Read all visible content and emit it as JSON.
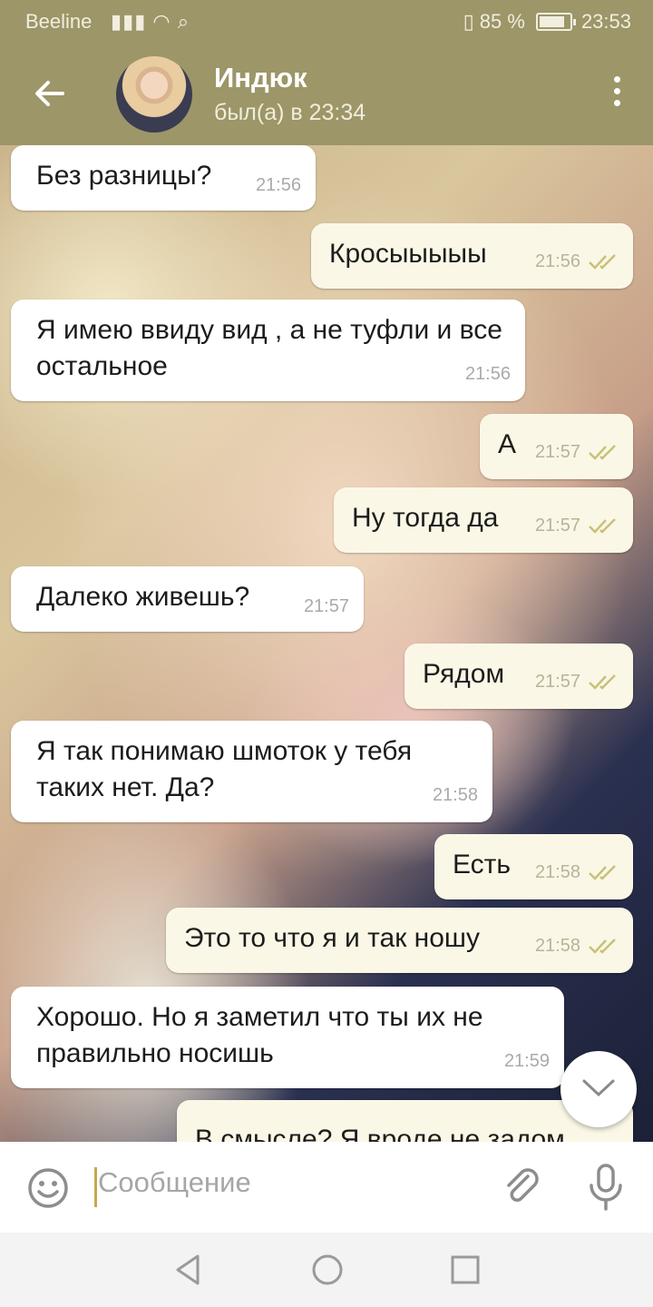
{
  "status_bar": {
    "carrier": "Beeline",
    "signal": "▮▮▮ ◠ ⌕",
    "vibrate": "▯",
    "battery_text": "85 %",
    "battery_level": 0.85,
    "time": "23:53"
  },
  "header": {
    "back_icon": "arrow-left-icon",
    "contact_name": "Индюк",
    "last_seen": "был(а) в 23:34",
    "menu_icon": "more-vertical-icon"
  },
  "messages": [
    {
      "direction": "in",
      "text": "Без разницы?",
      "time": "21:56"
    },
    {
      "direction": "out",
      "text": "Кросыыыыы",
      "time": "21:56",
      "status": "read"
    },
    {
      "direction": "in",
      "text": "Я имею ввиду вид , а не туфли и все остальное",
      "time": "21:56"
    },
    {
      "direction": "out",
      "text": "А",
      "time": "21:57",
      "status": "read"
    },
    {
      "direction": "out",
      "text": "Ну тогда да",
      "time": "21:57",
      "status": "read"
    },
    {
      "direction": "in",
      "text": "Далеко живешь?",
      "time": "21:57"
    },
    {
      "direction": "out",
      "text": "Рядом",
      "time": "21:57",
      "status": "read"
    },
    {
      "direction": "in",
      "text": "Я так понимаю шмоток у тебя таких нет. Да?",
      "time": "21:58"
    },
    {
      "direction": "out",
      "text": "Есть",
      "time": "21:58",
      "status": "read"
    },
    {
      "direction": "out",
      "text": "Это то что я и так ношу",
      "time": "21:58",
      "status": "read"
    },
    {
      "direction": "in",
      "text": "Хорошо. Но я заметил что ты их не правильно носишь",
      "time": "21:59"
    },
    {
      "direction": "out",
      "text": "В смысле? Я вроде не задом",
      "time": ""
    }
  ],
  "input": {
    "placeholder": "Сообщение",
    "emoji_icon": "emoji-icon",
    "attach_icon": "paperclip-icon",
    "mic_icon": "microphone-icon"
  },
  "colors": {
    "header": "#9c9668",
    "outgoing_bubble": "#fbf7e6",
    "incoming_bubble": "#ffffff",
    "read_checks": "#c9c07a"
  }
}
